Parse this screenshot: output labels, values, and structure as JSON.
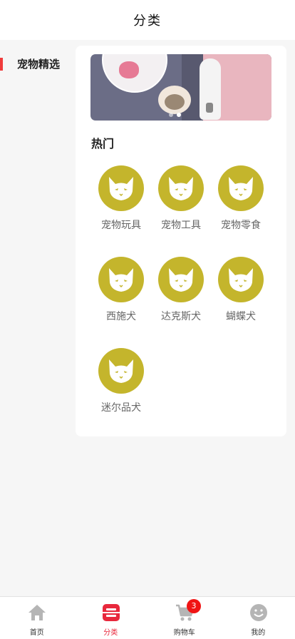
{
  "header": {
    "title": "分类"
  },
  "sidebar": {
    "items": [
      {
        "label": "宠物精选",
        "active": true
      }
    ]
  },
  "panel": {
    "banner": {
      "description_icon": "pet-banner",
      "dot_count": 2,
      "active_dot": 1
    },
    "section_title": "热门",
    "categories": [
      {
        "label": "宠物玩具",
        "icon": "cat-icon"
      },
      {
        "label": "宠物工具",
        "icon": "cat-icon"
      },
      {
        "label": "宠物零食",
        "icon": "cat-icon"
      },
      {
        "label": "西施犬",
        "icon": "cat-icon"
      },
      {
        "label": "达克斯犬",
        "icon": "cat-icon"
      },
      {
        "label": "蝴蝶犬",
        "icon": "cat-icon"
      },
      {
        "label": "迷尔品犬",
        "icon": "cat-icon"
      }
    ]
  },
  "tabbar": {
    "tabs": [
      {
        "label": "首页",
        "icon": "home-icon",
        "active": false
      },
      {
        "label": "分类",
        "icon": "category-icon",
        "active": true
      },
      {
        "label": "购物车",
        "icon": "cart-icon",
        "active": false
      },
      {
        "label": "我的",
        "icon": "profile-icon",
        "active": false
      }
    ],
    "cart_badge": "3"
  },
  "colors": {
    "accent": "#e8283c",
    "icon_circle": "#c4b52c",
    "badge": "#f01414"
  }
}
